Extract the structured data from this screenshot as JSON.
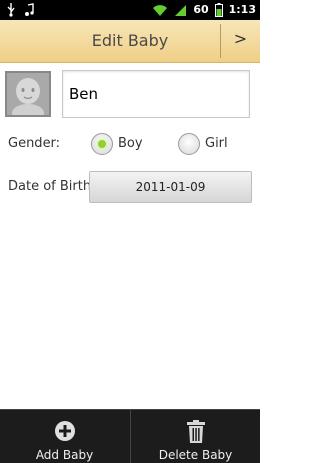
{
  "status_bar": {
    "battery_percent": "60",
    "time": "1:13",
    "icons": [
      "usb-icon",
      "music-icon",
      "wifi-icon",
      "signal-icon",
      "battery-icon"
    ]
  },
  "title_bar": {
    "title": "Edit Baby",
    "next_label": ">"
  },
  "baby": {
    "name": "Ben",
    "avatar_icon": "baby-avatar-icon"
  },
  "gender": {
    "label": "Gender:",
    "options": [
      {
        "label": "Boy",
        "selected": true
      },
      {
        "label": "Girl",
        "selected": false
      }
    ]
  },
  "date_of_birth": {
    "label": "Date of Birth:",
    "value": "2011-01-09"
  },
  "bottom_bar": {
    "add_label": "Add Baby",
    "add_icon": "plus-circle-icon",
    "delete_label": "Delete Baby",
    "delete_icon": "trash-icon"
  },
  "colors": {
    "title_bar": "#efcf86",
    "radio_selected": "#8fd32a",
    "bottom_bar": "#1c1c1c"
  }
}
